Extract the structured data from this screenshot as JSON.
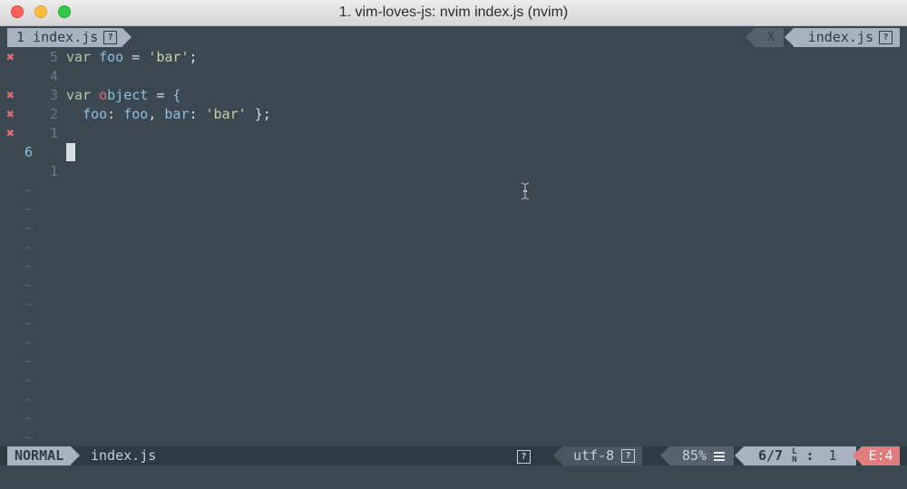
{
  "window": {
    "title": "1. vim-loves-js: nvim index.js (nvim)"
  },
  "tabline": {
    "left_tab_label": "1 index.js",
    "left_tab_icon": "?",
    "right_close_label": "X",
    "right_tab_label": "index.js",
    "right_tab_icon": "?"
  },
  "editor": {
    "lines": [
      {
        "sign": "✖",
        "number": "5",
        "tokens": [
          {
            "t": "var",
            "c": "kw"
          },
          {
            "t": " "
          },
          {
            "t": "foo",
            "c": "var"
          },
          {
            "t": " = "
          },
          {
            "t": "'bar'",
            "c": "str"
          },
          {
            "t": ";"
          }
        ]
      },
      {
        "sign": "",
        "number": "4",
        "tokens": []
      },
      {
        "sign": "✖",
        "number": "3",
        "tokens": [
          {
            "t": "var",
            "c": "kw"
          },
          {
            "t": " "
          },
          {
            "t": "o",
            "c": "obj-o"
          },
          {
            "t": "bject",
            "c": "var"
          },
          {
            "t": " = "
          },
          {
            "t": "{",
            "c": "brace"
          }
        ]
      },
      {
        "sign": "✖",
        "number": "2",
        "tokens": [
          {
            "t": "  "
          },
          {
            "t": "foo",
            "c": "var"
          },
          {
            "t": ": "
          },
          {
            "t": "foo",
            "c": "var"
          },
          {
            "t": ", "
          },
          {
            "t": "bar",
            "c": "var"
          },
          {
            "t": ": "
          },
          {
            "t": "'bar'",
            "c": "str"
          },
          {
            "t": " };"
          }
        ]
      },
      {
        "sign": "✖",
        "number": "1",
        "tokens": []
      },
      {
        "sign": "",
        "number": "6",
        "current": true,
        "tokens": [],
        "cursor": true
      },
      {
        "sign": "",
        "number": "1",
        "tokens": []
      }
    ],
    "tilde": "~",
    "tilde_count": 14
  },
  "statusline": {
    "mode": "NORMAL",
    "filename": "index.js",
    "file_icon": "?",
    "encoding": "utf-8",
    "encoding_icon": "?",
    "percent": "85%",
    "position": "6/7",
    "ln_top": "L",
    "ln_bottom": "N",
    "col_sep": ":",
    "column": "1",
    "errors": "E:4"
  },
  "colors": {
    "background": "#3b4751",
    "error_sign": "#e06c75",
    "status_accent": "#a7b3be",
    "error_badge": "#e07c7c"
  }
}
